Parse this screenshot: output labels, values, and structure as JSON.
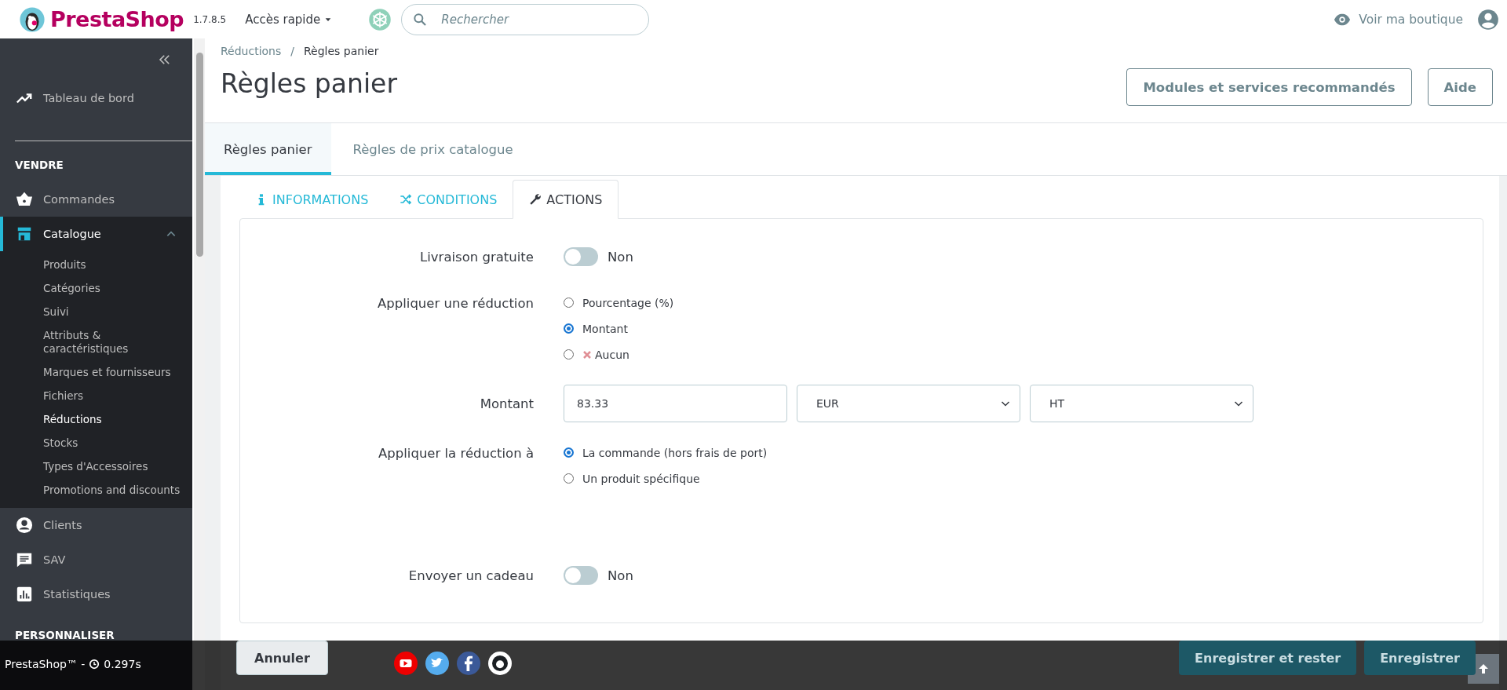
{
  "header": {
    "logo_text": "PrestaShop",
    "version": "1.7.8.5",
    "quick_access": "Accès rapide",
    "search": {
      "placeholder": "Rechercher"
    },
    "shop_link": "Voir ma boutique"
  },
  "sidebar": {
    "dashboard": "Tableau de bord",
    "sections": [
      {
        "title": "VENDRE",
        "items": [
          {
            "label": "Commandes",
            "expanded": false,
            "selected": false
          },
          {
            "label": "Catalogue",
            "expanded": true,
            "selected": true,
            "children": [
              {
                "label": "Produits",
                "selected": false
              },
              {
                "label": "Catégories",
                "selected": false
              },
              {
                "label": "Suivi",
                "selected": false
              },
              {
                "label": "Attributs & caractéristiques",
                "selected": false
              },
              {
                "label": "Marques et fournisseurs",
                "selected": false
              },
              {
                "label": "Fichiers",
                "selected": false
              },
              {
                "label": "Réductions",
                "selected": true
              },
              {
                "label": "Stocks",
                "selected": false
              },
              {
                "label": "Types d'Accessoires",
                "selected": false
              },
              {
                "label": "Promotions and discounts",
                "selected": false
              }
            ]
          },
          {
            "label": "Clients",
            "expanded": false,
            "selected": false
          },
          {
            "label": "SAV",
            "expanded": false,
            "selected": false
          },
          {
            "label": "Statistiques",
            "expanded": false,
            "selected": false
          }
        ]
      },
      {
        "title": "PERSONNALISER"
      }
    ]
  },
  "breadcrumb": {
    "separator": "/",
    "items": [
      "Réductions",
      "Règles panier"
    ]
  },
  "title": "Règles panier",
  "header_buttons": [
    "Modules et services recommandés",
    "Aide"
  ],
  "tabs": [
    {
      "label": "Règles panier",
      "selected": true
    },
    {
      "label": "Règles de prix catalogue",
      "selected": false
    }
  ],
  "subtabs": [
    {
      "label": "INFORMATIONS",
      "selected": false
    },
    {
      "label": "CONDITIONS",
      "selected": false
    },
    {
      "label": "ACTIONS",
      "selected": true
    }
  ],
  "form": [
    {
      "kind": "toggle",
      "label": "Livraison gratuite",
      "on": false,
      "state_text": "Non"
    },
    {
      "kind": "radio",
      "label": "Appliquer une réduction",
      "options": [
        {
          "label": "Pourcentage (%)",
          "selected": false,
          "kind": "plain"
        },
        {
          "label": "Montant",
          "selected": true,
          "kind": "plain"
        },
        {
          "label": "Aucun",
          "selected": false,
          "kind": "cross"
        }
      ]
    },
    {
      "kind": "amount",
      "label": "Montant",
      "value": "83.33",
      "selects": [
        "EUR",
        "HT"
      ]
    },
    {
      "kind": "radio",
      "label": "Appliquer la réduction à",
      "options": [
        {
          "label": "La commande (hors frais de port)",
          "selected": true,
          "kind": "plain"
        },
        {
          "label": "Un produit spécifique",
          "selected": false,
          "kind": "plain"
        }
      ]
    },
    {
      "kind": "spacer"
    },
    {
      "kind": "toggle",
      "label": "Envoyer un cadeau",
      "on": false,
      "state_text": "Non"
    }
  ],
  "footer_buttons": [
    "Annuler",
    "Enregistrer et rester",
    "Enregistrer"
  ],
  "debug_bar": {
    "text": "PrestaShop™ -",
    "time": "0.297s"
  }
}
